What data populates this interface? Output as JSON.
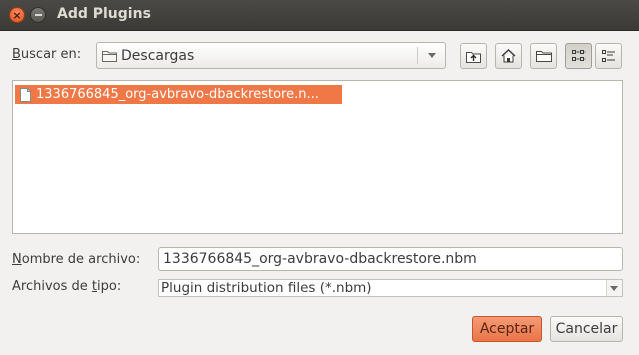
{
  "window": {
    "title": "Add Plugins",
    "buttons": {
      "close": "close",
      "minimize": "minimize"
    }
  },
  "location": {
    "label_prefix": "B",
    "label_rest": "uscar en:",
    "current_folder": "Descargas",
    "folder_icon": "folder-icon"
  },
  "toolbar": {
    "icons": [
      "up-folder-icon",
      "home-icon",
      "new-folder-icon",
      "list-view-icon",
      "details-view-icon"
    ]
  },
  "files": [
    {
      "name": "1336766845_org-avbravo-dbackrestore.n...",
      "selected": true
    }
  ],
  "filename": {
    "label_prefix": "N",
    "label_rest": "ombre de archivo:",
    "value": "1336766845_org-avbravo-dbackrestore.nbm"
  },
  "filetype": {
    "label_start": "Archivos de ",
    "label_underlined": "t",
    "label_end": "ipo:",
    "value": "Plugin distribution files (*.nbm)"
  },
  "actions": {
    "accept_label": "Aceptar",
    "cancel_label": "Cancelar"
  },
  "colors": {
    "accent": "#f07746",
    "titlebar": "#3c3b37"
  }
}
